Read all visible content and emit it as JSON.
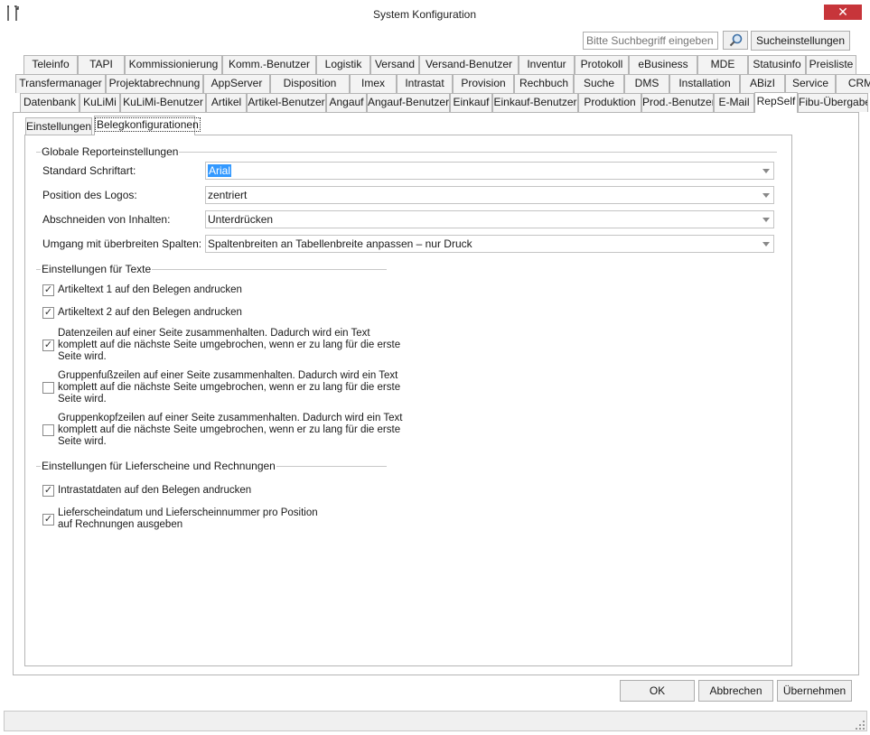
{
  "window": {
    "title": "System Konfiguration",
    "close_glyph": "✕"
  },
  "search": {
    "placeholder": "Bitte Suchbegriff eingeben",
    "settings_label": "Sucheinstellungen"
  },
  "tabs_row1": [
    "Teleinfo",
    "TAPI",
    "Kommissionierung",
    "Komm.-Benutzer",
    "Logistik",
    "Versand",
    "Versand-Benutzer",
    "Inventur",
    "Protokoll",
    "eBusiness",
    "MDE",
    "Statusinfo",
    "Preisliste"
  ],
  "tabs_row2": [
    "Transfermanager",
    "Projektabrechnung",
    "AppServer",
    "Disposition",
    "Imex",
    "Intrastat",
    "Provision",
    "Rechbuch",
    "Suche",
    "DMS",
    "Installation",
    "ABizI",
    "Service",
    "CRM"
  ],
  "tabs_row3": [
    "Datenbank",
    "KuLiMi",
    "KuLiMi-Benutzer",
    "Artikel",
    "Artikel-Benutzer",
    "Angauf",
    "Angauf-Benutzer",
    "Einkauf",
    "Einkauf-Benutzer",
    "Produktion",
    "Prod.-Benutzer",
    "E-Mail",
    "RepSelf",
    "Fibu-Übergabe"
  ],
  "subtabs": [
    "Einstellungen",
    "Belegkonfigurationen"
  ],
  "group_global": {
    "title": "Globale Reporteinstellungen",
    "rows": [
      {
        "label": "Standard Schriftart:",
        "value": "Arial"
      },
      {
        "label": "Position des Logos:",
        "value": "zentriert"
      },
      {
        "label": "Abschneiden von Inhalten:",
        "value": "Unterdrücken"
      },
      {
        "label": "Umgang mit überbreiten Spalten:",
        "value": "Spaltenbreiten an Tabellenbreite anpassen – nur Druck"
      }
    ]
  },
  "group_texts": {
    "title": "Einstellungen für Texte",
    "items": [
      {
        "lines": [
          "Artikeltext 1 auf den Belegen andrucken"
        ],
        "checked": true
      },
      {
        "lines": [
          "Artikeltext 2 auf den Belegen andrucken"
        ],
        "checked": true
      },
      {
        "lines": [
          "Datenzeilen auf einer Seite zusammenhalten. Dadurch wird ein Text",
          "komplett auf die nächste Seite umgebrochen, wenn er zu lang für die erste",
          "Seite wird."
        ],
        "checked": true
      },
      {
        "lines": [
          "Gruppenfußzeilen auf einer Seite zusammenhalten. Dadurch wird ein Text",
          "komplett auf die nächste Seite umgebrochen, wenn er zu lang für die erste",
          "Seite wird."
        ],
        "checked": false
      },
      {
        "lines": [
          "Gruppenkopfzeilen auf einer Seite zusammenhalten. Dadurch wird ein Text",
          "komplett auf die nächste Seite umgebrochen, wenn er zu lang für die erste",
          "Seite wird."
        ],
        "checked": false
      }
    ]
  },
  "group_delivery": {
    "title": "Einstellungen für Lieferscheine und Rechnungen",
    "items": [
      {
        "lines": [
          "Intrastatdaten auf den Belegen andrucken"
        ],
        "checked": true
      },
      {
        "lines": [
          "Lieferscheindatum und Lieferscheinnummer pro Position",
          "auf Rechnungen ausgeben"
        ],
        "checked": true
      }
    ]
  },
  "buttons": {
    "ok": "OK",
    "cancel": "Abbrechen",
    "apply": "Übernehmen"
  },
  "colors": {
    "close": "#c7353a",
    "selection": "#3399ff"
  }
}
